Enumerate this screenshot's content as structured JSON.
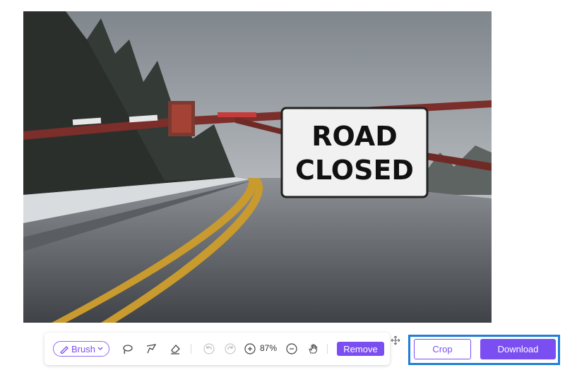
{
  "canvas": {
    "image_description_icon": "photo-road-closed-sign",
    "sign_line1": "ROAD",
    "sign_line2": "CLOSED"
  },
  "toolbar": {
    "brush_label": "Brush",
    "brush_icon": "brush-icon",
    "lasso_icon": "lasso-icon",
    "polygon_lasso_icon": "polygon-lasso-icon",
    "eraser_icon": "eraser-icon",
    "undo_icon": "undo-icon",
    "redo_icon": "redo-icon",
    "zoom_in_icon": "zoom-in-icon",
    "zoom_level": "87%",
    "zoom_out_icon": "zoom-out-icon",
    "pan_icon": "hand-icon",
    "remove_label": "Remove"
  },
  "actions": {
    "crop_label": "Crop",
    "download_label": "Download"
  },
  "colors": {
    "accent": "#7b4ef2",
    "highlight": "#1e7fd8"
  }
}
